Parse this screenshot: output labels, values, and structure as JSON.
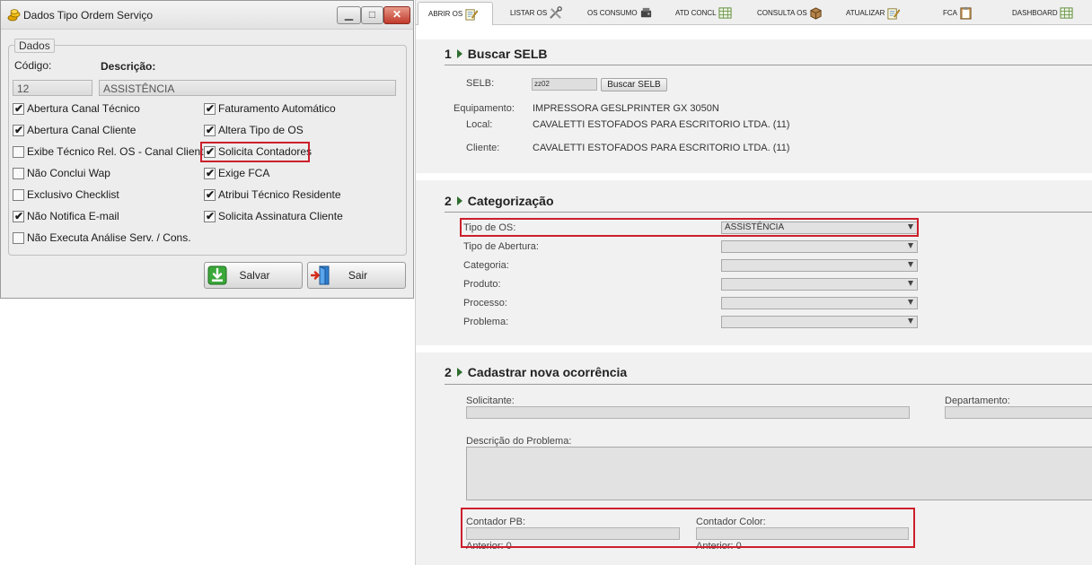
{
  "dialog": {
    "title": "Dados Tipo Ordem Serviço",
    "window_buttons": {
      "minimize": "▁",
      "maximize": "□",
      "close": "✕"
    },
    "group_label": "Dados",
    "codigo_label": "Código:",
    "descricao_label": "Descrição:",
    "codigo_value": "12",
    "descricao_value": "ASSISTÊNCIA",
    "checks_left": [
      {
        "label": "Abertura Canal Técnico",
        "checked": true
      },
      {
        "label": "Abertura Canal Cliente",
        "checked": true
      },
      {
        "label": "Exibe Técnico Rel. OS - Canal Cliente",
        "checked": false
      },
      {
        "label": "Não Conclui Wap",
        "checked": false
      },
      {
        "label": "Exclusivo Checklist",
        "checked": false
      },
      {
        "label": "Não Notifica E-mail",
        "checked": true
      },
      {
        "label": "Não Executa Análise Serv. / Cons.",
        "checked": false
      }
    ],
    "checks_right": [
      {
        "label": "Faturamento Automático",
        "checked": true
      },
      {
        "label": "Altera Tipo de OS",
        "checked": true
      },
      {
        "label": "Solicita Contadores",
        "checked": true
      },
      {
        "label": "Exige FCA",
        "checked": true
      },
      {
        "label": "Atribui Técnico Residente",
        "checked": true
      },
      {
        "label": "Solicita Assinatura Cliente",
        "checked": true
      }
    ],
    "check_glyph": "✔",
    "save_label": "Salvar",
    "exit_label": "Sair"
  },
  "tabs": [
    {
      "label": "ABRIR OS",
      "icon": "notepad-pencil-icon"
    },
    {
      "label": "LISTAR OS",
      "icon": "tools-icon"
    },
    {
      "label": "OS CONSUMO",
      "icon": "toner-icon"
    },
    {
      "label": "ATD CONCL",
      "icon": "spreadsheet-icon"
    },
    {
      "label": "CONSULTA OS",
      "icon": "box-icon"
    },
    {
      "label": "ATUALIZAR",
      "icon": "notepad-pencil-icon"
    },
    {
      "label": "FCA",
      "icon": "clipboard-icon"
    },
    {
      "label": "DASHBOARD",
      "icon": "spreadsheet-icon"
    }
  ],
  "section1": {
    "num": "1",
    "title": "Buscar SELB",
    "selb_label": "SELB:",
    "selb_value": "zz02",
    "search_button": "Buscar SELB",
    "equipamento_label": "Equipamento:",
    "equipamento_value": "IMPRESSORA GESLPRINTER GX 3050N",
    "local_label": "Local:",
    "local_value": "CAVALETTI ESTOFADOS PARA ESCRITORIO LTDA. (11)",
    "cliente_label": "Cliente:",
    "cliente_value": "CAVALETTI ESTOFADOS PARA ESCRITORIO LTDA. (11)"
  },
  "section2": {
    "num": "2",
    "title": "Categorização",
    "fields": [
      {
        "label": "Tipo de OS:",
        "value": "ASSISTÊNCIA"
      },
      {
        "label": "Tipo de Abertura:",
        "value": ""
      },
      {
        "label": "Categoria:",
        "value": ""
      },
      {
        "label": "Produto:",
        "value": ""
      },
      {
        "label": "Processo:",
        "value": ""
      },
      {
        "label": "Problema:",
        "value": ""
      }
    ]
  },
  "section3": {
    "num": "2",
    "title": "Cadastrar nova ocorrência",
    "solicitante_label": "Solicitante:",
    "departamento_label": "Departamento:",
    "descricao_label": "Descrição do Problema:",
    "contador_pb_label": "Contador PB:",
    "contador_color_label": "Contador Color:",
    "anterior_pb": "Anterior: 0",
    "anterior_color": "Anterior: 0"
  },
  "colors": {
    "highlight": "#cc1f2b",
    "arrow": "#2f6d2f"
  }
}
